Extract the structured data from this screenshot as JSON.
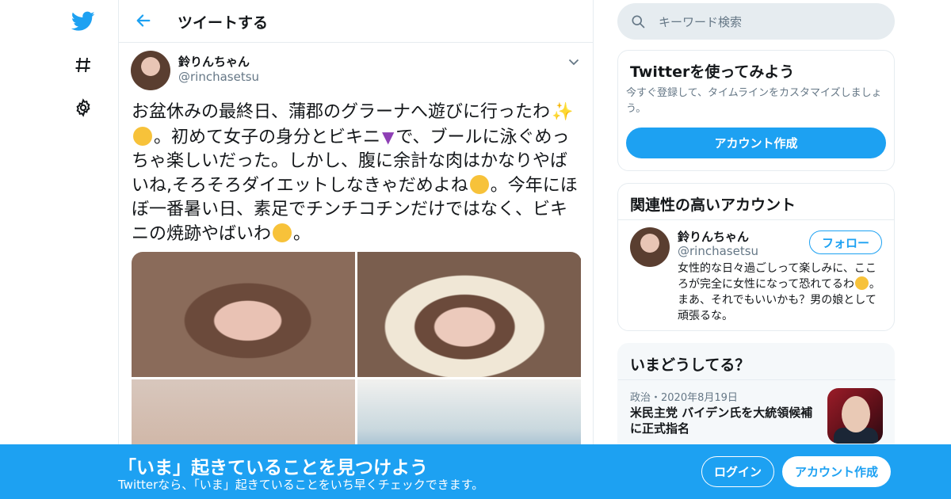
{
  "colors": {
    "accent": "#1da1f2",
    "text": "#14171a",
    "muted": "#657786",
    "border": "#e6ecf0"
  },
  "nav": {
    "items": [
      {
        "icon": "twitter-logo-icon"
      },
      {
        "icon": "hashtag-icon"
      },
      {
        "icon": "gear-icon"
      }
    ]
  },
  "header": {
    "title": "ツイートする"
  },
  "tweet": {
    "author_name": "鈴りんちゃん",
    "author_handle": "@rinchasetsu",
    "text_parts": {
      "p1": "お盆休みの最終日、蒲郡のグラーナへ遊びに行ったわ",
      "p2": "。初めて女子の身分とビキニ",
      "p3": "で、ブールに泳ぐめっちゃ楽しいだった。しかし、腹に余計な肉はかなりやばいね,そろそろダイエットしなきゃだめよね",
      "p4": "。今年にほぼ一番暑い日、素足でチンチコチンだけではなく、ビキニの焼跡やばいわ",
      "p5": "。"
    },
    "media_count": 4
  },
  "search": {
    "placeholder": "キーワード検索"
  },
  "signup_card": {
    "title": "Twitterを使ってみよう",
    "description": "今すぐ登録して、タイムラインをカスタマイズしましょう。",
    "button": "アカウント作成"
  },
  "related_card": {
    "title": "関連性の高いアカウント",
    "name": "鈴りんちゃん",
    "handle": "@rinchasetsu",
    "follow_button": "フォロー",
    "bio_a": "女性的な日々過ごしって楽しみに、こころが完全に女性になって恐れてるわ",
    "bio_b": "。まあ、それでもいいかも？男の娘として頑張るな。"
  },
  "trends_card": {
    "title": "いまどうしてる？",
    "meta": "政治・2020年8月19日",
    "headline": "米民主党 バイデン氏を大統領候補に正式指名"
  },
  "banner": {
    "title": "「いま」起きていることを見つけよう",
    "subtitle": "Twitterなら、「いま」起きていることをいち早くチェックできます。",
    "login_button": "ログイン",
    "signup_button": "アカウント作成"
  }
}
